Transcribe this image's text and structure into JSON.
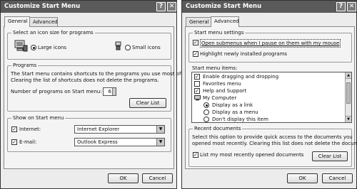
{
  "left": {
    "title": "Customize Start Menu",
    "title_help": "?",
    "title_close": "✕",
    "tabs": [
      "General",
      "Advanced"
    ],
    "icon_size_group": "Select an icon size for programs",
    "large_icons": "Large icons",
    "small_icons": "Small icons",
    "programs_group": "Programs",
    "programs_desc_1": "The Start menu contains shortcuts to the programs you use most often.",
    "programs_desc_2": "Clearing the list of shortcuts does not delete the programs.",
    "num_programs_label": "Number of programs on Start menu:",
    "num_programs_value": "6",
    "clear_list": "Clear List",
    "show_group": "Show on Start menu",
    "internet_label": "Internet:",
    "internet_value": "Internet Explorer",
    "email_label": "E-mail:",
    "email_value": "Outlook Express",
    "ok": "OK",
    "cancel": "Cancel"
  },
  "right": {
    "title": "Customize Start Menu",
    "title_help": "?",
    "title_close": "✕",
    "tabs": [
      "General",
      "Advanced"
    ],
    "settings_group": "Start menu settings",
    "open_submenus": "Open submenus when I pause on them with my mouse",
    "highlight_new": "Highlight newly installed programs",
    "items_label": "Start menu items:",
    "items": [
      {
        "label": "Enable dragging and dropping",
        "control": "checkbox",
        "checked": true
      },
      {
        "label": "Favorites menu",
        "control": "checkbox",
        "checked": false
      },
      {
        "label": "Help and Support",
        "control": "checkbox",
        "checked": true
      },
      {
        "label": "My Computer",
        "control": "folder",
        "checked": false
      },
      {
        "label": "Display as a link",
        "control": "radio",
        "checked": true
      },
      {
        "label": "Display as a menu",
        "control": "radio",
        "checked": false
      },
      {
        "label": "Don't display this item",
        "control": "radio",
        "checked": false
      }
    ],
    "recent_group": "Recent documents",
    "recent_desc_1": "Select this option to provide quick access to the documents you",
    "recent_desc_2": "opened most recently. Clearing this list does not delete the documents.",
    "list_recent": "List my most recently opened documents",
    "clear_list": "Clear List",
    "ok": "OK",
    "cancel": "Cancel"
  },
  "checkmark": "✓"
}
